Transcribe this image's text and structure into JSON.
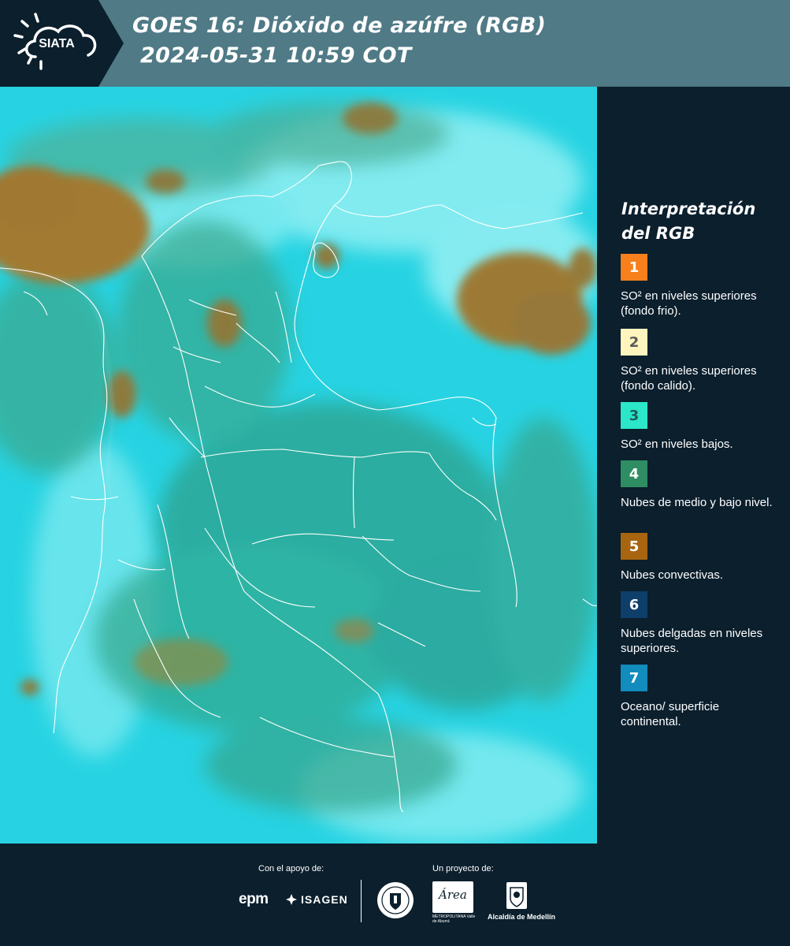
{
  "header": {
    "logo_text": "SIATA",
    "title_line1": "GOES 16: Dióxido de azúfre (RGB)",
    "title_line2": "2024-05-31 10:59 COT",
    "background_color": "#4f7a86",
    "logo_background_color": "#0b1f2d"
  },
  "map": {
    "product": "GOES 16 SO2 RGB",
    "base_color": "#27d3e2",
    "land_color": "#2faa8a",
    "convective_color": "#a07a2e",
    "border_color": "#ffffff"
  },
  "legend": {
    "title": "Interpretación del RGB",
    "items": [
      {
        "number": "1",
        "color": "#f7801c",
        "number_color": "#ffffff",
        "text": "SO² en niveles superiores (fondo frio)."
      },
      {
        "number": "2",
        "color": "#fdf5bd",
        "number_color": "#5a5a5a",
        "text": "SO² en niveles superiores (fondo calido)."
      },
      {
        "number": "3",
        "color": "#2be6c9",
        "number_color": "#1b5e5a",
        "text": "SO² en niveles bajos."
      },
      {
        "number": "4",
        "color": "#2f8d63",
        "number_color": "#ffffff",
        "text": "Nubes de medio y bajo nivel."
      },
      {
        "number": "5",
        "color": "#a8650f",
        "number_color": "#ffffff",
        "text": "Nubes convectivas."
      },
      {
        "number": "6",
        "color": "#0e3e6a",
        "number_color": "#ffffff",
        "text": "Nubes delgadas en niveles superiores."
      },
      {
        "number": "7",
        "color": "#128bbd",
        "number_color": "#ffffff",
        "text": "Oceano/ superficie continental."
      }
    ]
  },
  "footer": {
    "support_label": "Con el apoyo de:",
    "project_label": "Un proyecto de:",
    "sponsors": [
      "epm",
      "ISAGEN"
    ],
    "area_word": "Área",
    "area_subtitle": "METROPOLITANA Valle de Aburrá",
    "alcaldia_label": "Alcaldía de Medellín"
  }
}
